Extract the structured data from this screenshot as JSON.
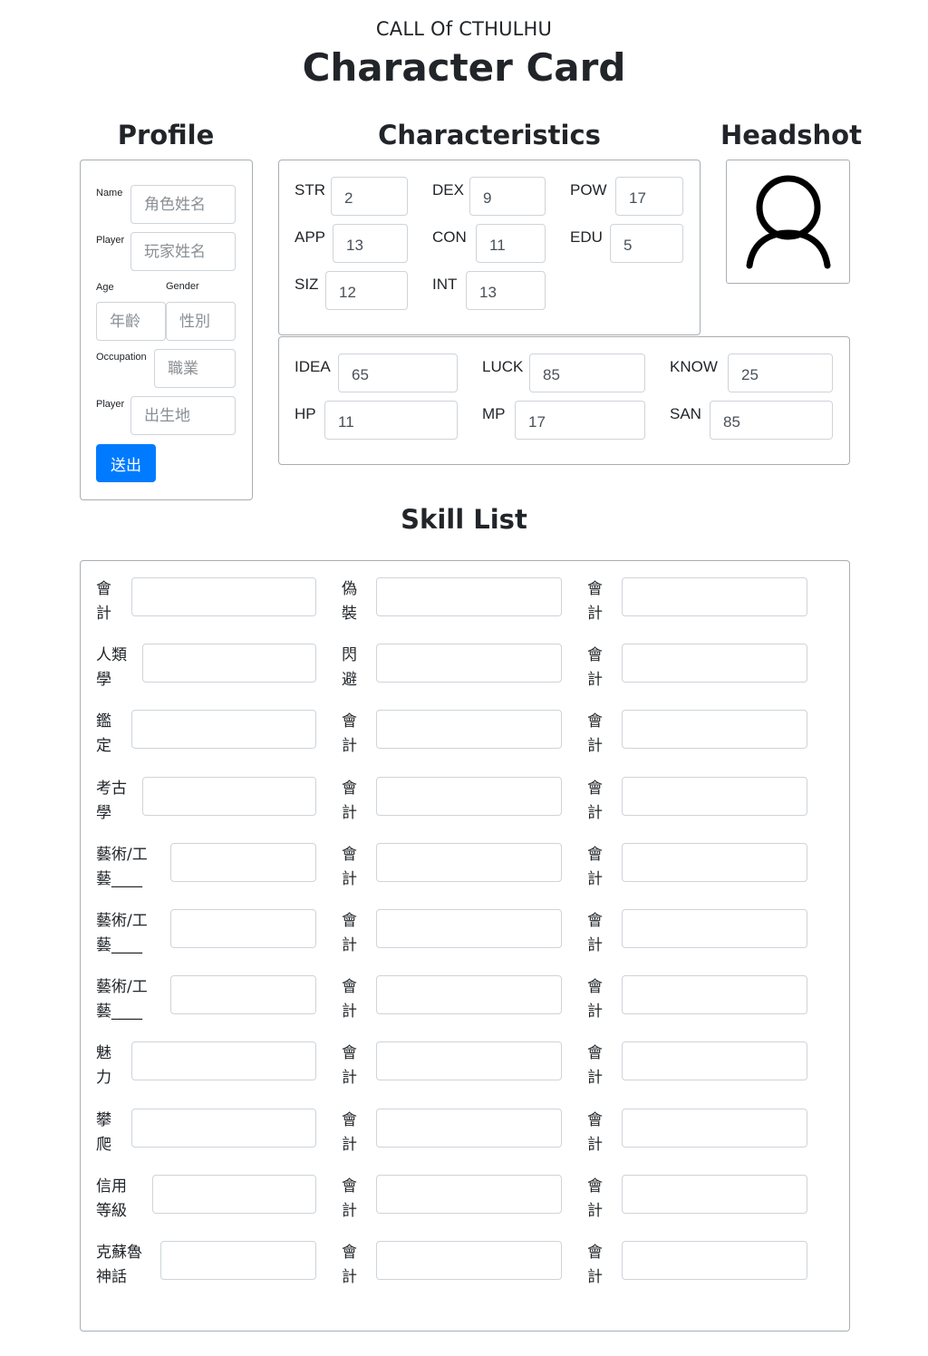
{
  "header": {
    "supertitle": "CALL Of CTHULHU",
    "title": "Character Card"
  },
  "sections": {
    "profile": "Profile",
    "characteristics": "Characteristics",
    "headshot": "Headshot",
    "skills": "Skill List"
  },
  "profile": {
    "name_label": "Name",
    "name_placeholder": "角色姓名",
    "player_label": "Player",
    "player_placeholder": "玩家姓名",
    "age_label": "Age",
    "age_placeholder": "年齡",
    "gender_label": "Gender",
    "gender_placeholder": "性別",
    "occupation_label": "Occupation",
    "occupation_placeholder": "職業",
    "birthplace_label": "Player",
    "birthplace_placeholder": "出生地",
    "submit_label": "送出"
  },
  "characteristics": [
    {
      "label": "STR",
      "value": "2"
    },
    {
      "label": "DEX",
      "value": "9"
    },
    {
      "label": "POW",
      "value": "17"
    },
    {
      "label": "APP",
      "value": "13"
    },
    {
      "label": "CON",
      "value": "11"
    },
    {
      "label": "EDU",
      "value": "5"
    },
    {
      "label": "SIZ",
      "value": "12"
    },
    {
      "label": "INT",
      "value": "13"
    }
  ],
  "derived": [
    {
      "label": "IDEA",
      "value": "65"
    },
    {
      "label": "LUCK",
      "value": "85"
    },
    {
      "label": "KNOW",
      "value": "25"
    },
    {
      "label": "HP",
      "value": "11"
    },
    {
      "label": "MP",
      "value": "17"
    },
    {
      "label": "SAN",
      "value": "85"
    }
  ],
  "headshot": {
    "icon": "user-silhouette-icon"
  },
  "skills": {
    "col1": [
      "會\n計",
      "人類\n學",
      "鑑\n定",
      "考古\n學",
      "藝術/工\n藝____",
      "藝術/工\n藝____",
      "藝術/工\n藝____",
      "魅\n力",
      "攀\n爬",
      "信用\n等級",
      "克蘇魯\n神話"
    ],
    "col2": [
      "偽\n裝",
      "閃\n避",
      "會\n計",
      "會\n計",
      "會\n計",
      "會\n計",
      "會\n計",
      "會\n計",
      "會\n計",
      "會\n計",
      "會\n計"
    ],
    "col3": [
      "會\n計",
      "會\n計",
      "會\n計",
      "會\n計",
      "會\n計",
      "會\n計",
      "會\n計",
      "會\n計",
      "會\n計",
      "會\n計",
      "會\n計"
    ]
  }
}
